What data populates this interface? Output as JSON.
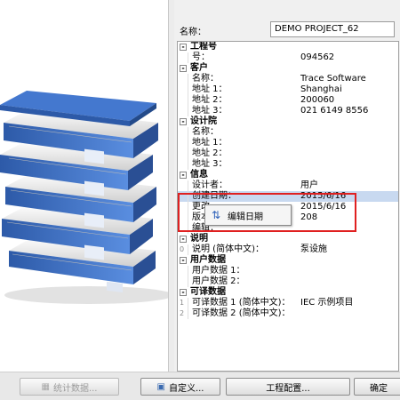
{
  "header": {
    "name_label": "名称：",
    "name_value": "DEMO PROJECT_62"
  },
  "tree": [
    {
      "type": "cat",
      "label": "工程号"
    },
    {
      "type": "prop",
      "key": "号：",
      "value": "094562"
    },
    {
      "type": "cat",
      "label": "客户"
    },
    {
      "type": "prop",
      "key": "名称：",
      "value": "Trace Software"
    },
    {
      "type": "prop",
      "key": "地址 1：",
      "value": "Shanghai"
    },
    {
      "type": "prop",
      "key": "地址 2：",
      "value": "200060"
    },
    {
      "type": "prop",
      "key": "地址 3：",
      "value": "021 6149 8556"
    },
    {
      "type": "cat",
      "label": "设计院"
    },
    {
      "type": "prop",
      "key": "名称：",
      "value": ""
    },
    {
      "type": "prop",
      "key": "地址 1：",
      "value": ""
    },
    {
      "type": "prop",
      "key": "地址 2：",
      "value": ""
    },
    {
      "type": "prop",
      "key": "地址 3：",
      "value": ""
    },
    {
      "type": "cat",
      "label": "信息"
    },
    {
      "type": "prop",
      "key": "设计者：",
      "value": "用户"
    },
    {
      "type": "prop",
      "key": "创建日期：",
      "value": "2015/6/16",
      "selected": true
    },
    {
      "type": "prop",
      "key": "更改",
      "value": "2015/6/16"
    },
    {
      "type": "prop",
      "key": "版本",
      "value": "208"
    },
    {
      "type": "prop",
      "key": "编辑：",
      "value": ""
    },
    {
      "type": "cat",
      "label": "说明"
    },
    {
      "type": "prop",
      "key": "说明 (简体中文)：",
      "value": "泵设施",
      "gutter": "0"
    },
    {
      "type": "cat",
      "label": "用户数据"
    },
    {
      "type": "prop",
      "key": "用户数据 1：",
      "value": ""
    },
    {
      "type": "prop",
      "key": "用户数据 2：",
      "value": ""
    },
    {
      "type": "cat",
      "label": "可译数据"
    },
    {
      "type": "prop",
      "key": "可译数据 1 (简体中文)：",
      "value": "IEC 示例项目",
      "gutter": "1"
    },
    {
      "type": "prop",
      "key": "可译数据 2 (简体中文)：",
      "value": "",
      "gutter": "2"
    }
  ],
  "popup": {
    "label": "编辑日期",
    "icon": "sync-icon"
  },
  "buttons": {
    "stats": "统计数据...",
    "custom": "自定义...",
    "config": "工程配置...",
    "ok": "确定"
  },
  "colors": {
    "highlight": "#e02020",
    "binder": "#3e6fc0",
    "selection": "#c8d9f0"
  }
}
